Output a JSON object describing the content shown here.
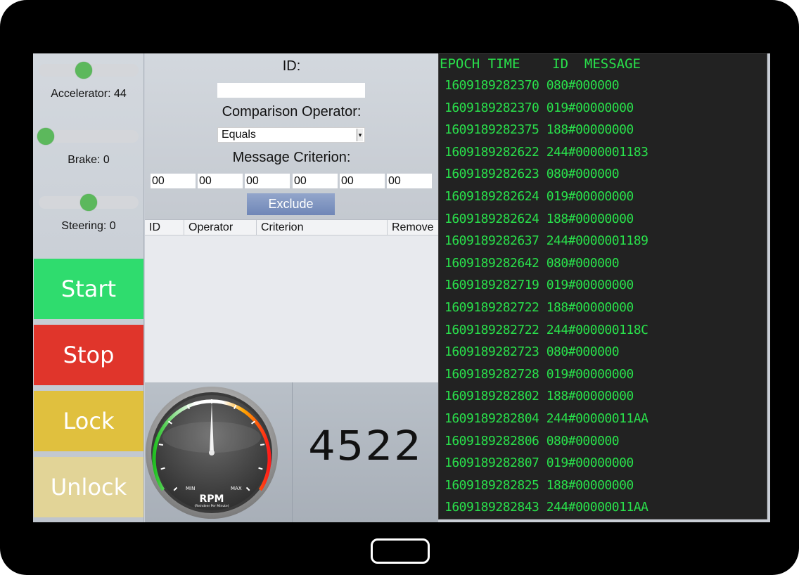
{
  "controls": {
    "accelerator": {
      "label": "Accelerator: 44",
      "value": 44,
      "max": 100
    },
    "brake": {
      "label": "Brake: 0",
      "value": 0,
      "max": 100
    },
    "steering": {
      "label": "Steering: 0",
      "value": 0,
      "min": -100,
      "max": 100
    },
    "buttons": {
      "start": {
        "label": "Start",
        "color": "#2fdc6e"
      },
      "stop": {
        "label": "Stop",
        "color": "#e0352b"
      },
      "lock": {
        "label": "Lock",
        "color": "#e0c03e"
      },
      "unlock": {
        "label": "Unlock",
        "color": "#e2d497"
      }
    }
  },
  "filter": {
    "id_label": "ID:",
    "id_value": "",
    "operator_label": "Comparison Operator:",
    "operator_value": "Equals",
    "criterion_label": "Message Criterion:",
    "criterion_bytes": [
      "00",
      "00",
      "00",
      "00",
      "00",
      "00"
    ],
    "exclude_label": "Exclude"
  },
  "filter_table": {
    "headers": [
      "ID",
      "Operator",
      "Criterion",
      "Remove"
    ],
    "rows": []
  },
  "gauge": {
    "label": "RPM",
    "sublabel": "(Reindeer Per Minute)",
    "min_label": "MIN",
    "max_label": "MAX",
    "level_fraction": 0.5
  },
  "rpm_display": "4522",
  "log": {
    "header": "EPOCH TIME    ID  MESSAGE",
    "rows": [
      "1609189282370 080#000000",
      "1609189282370 019#00000000",
      "1609189282375 188#00000000",
      "1609189282622 244#0000001183",
      "1609189282623 080#000000",
      "1609189282624 019#00000000",
      "1609189282624 188#00000000",
      "1609189282637 244#0000001189",
      "1609189282642 080#000000",
      "1609189282719 019#00000000",
      "1609189282722 188#00000000",
      "1609189282722 244#000000118C",
      "1609189282723 080#000000",
      "1609189282728 019#00000000",
      "1609189282802 188#00000000",
      "1609189282804 244#00000011AA",
      "1609189282806 080#000000",
      "1609189282807 019#00000000",
      "1609189282825 188#00000000",
      "1609189282843 244#00000011AA"
    ]
  }
}
